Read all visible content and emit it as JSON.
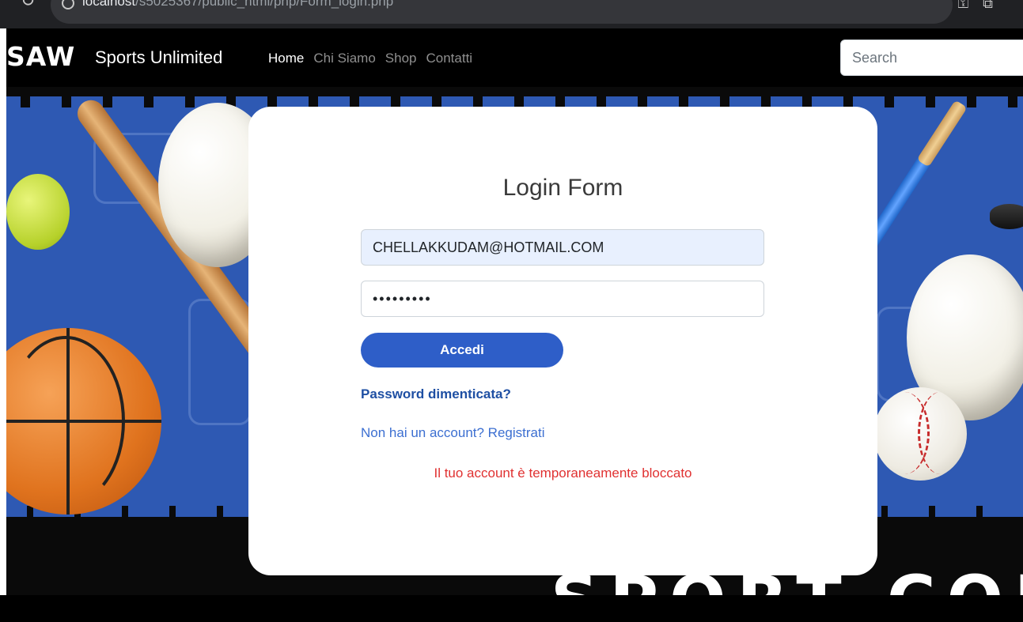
{
  "browser": {
    "url_host": "localhost",
    "url_path": "/s5025367/public_html/php/Form_login.php"
  },
  "navbar": {
    "logo": "SAW",
    "brand_name": "Sports Unlimited",
    "links": [
      {
        "label": "Home",
        "active": true
      },
      {
        "label": "Chi Siamo",
        "active": false
      },
      {
        "label": "Shop",
        "active": false
      },
      {
        "label": "Contatti",
        "active": false
      }
    ],
    "search_placeholder": "Search"
  },
  "hero": {
    "banner_text": "SPORT COLL"
  },
  "login": {
    "title": "Login Form",
    "email_value": "CHELLAKKUDAM@HOTMAIL.COM",
    "password_value": "•••••••••",
    "submit_label": "Accedi",
    "forgot_link": "Password dimenticata?",
    "register_link": "Non hai un account? Registrati",
    "error_message": "Il tuo account è temporaneamente bloccato"
  },
  "colors": {
    "primary": "#2e5ec8",
    "hero_blue": "#2e59b3",
    "error": "#e03131",
    "autofill": "#e8f0fe"
  },
  "icons": {
    "reload": "reload-icon",
    "info": "info-icon"
  }
}
